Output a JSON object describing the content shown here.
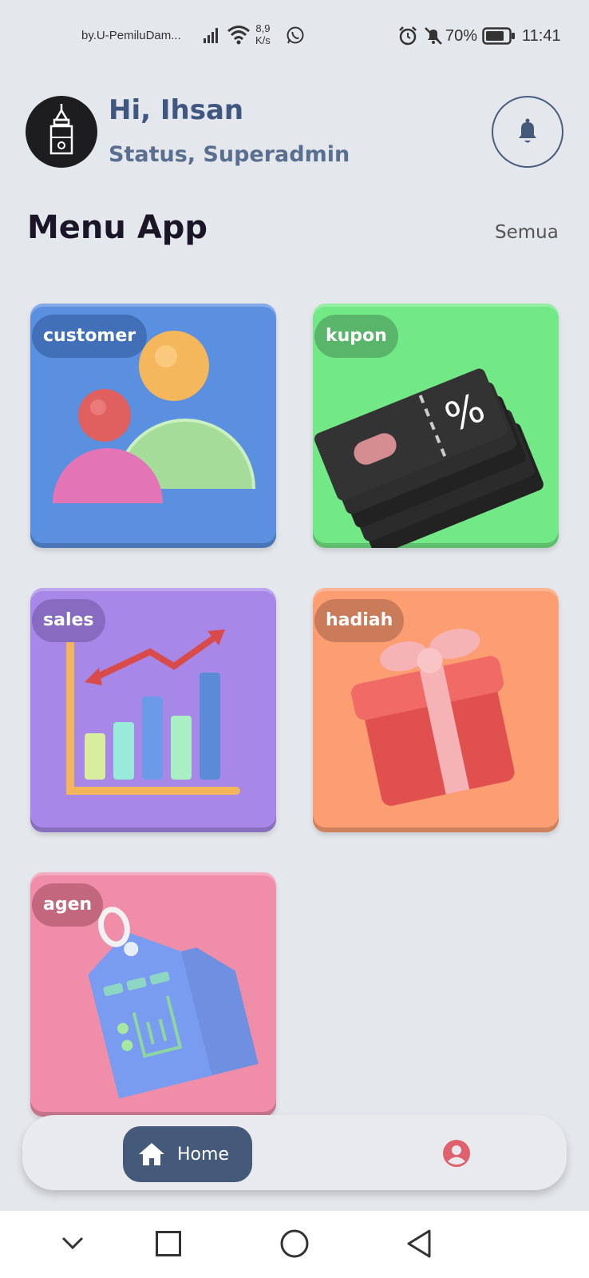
{
  "status_bar": {
    "carrier_text": "by.U-PemiluDam...",
    "speed_top": "8,9",
    "speed_bottom": "K/s",
    "battery": "70%",
    "time": "11:41"
  },
  "header": {
    "greeting": "Hi, Ihsan",
    "status": "Status, Superadmin"
  },
  "section": {
    "title": "Menu App",
    "see_all": "Semua"
  },
  "menu": [
    {
      "label": "customer",
      "color": "#5b8fe0"
    },
    {
      "label": "kupon",
      "color": "#72e886"
    },
    {
      "label": "sales",
      "color": "#a788e8"
    },
    {
      "label": "hadiah",
      "color": "#fc9e72"
    },
    {
      "label": "agen",
      "color": "#f08eaa"
    }
  ],
  "bottom_nav": {
    "home_label": "Home",
    "icons": [
      "home-icon",
      "profile-icon"
    ]
  },
  "colors": {
    "accent": "#455a7b",
    "greeting": "#3f5680",
    "profile": "#e0616e",
    "background": "#e4e7ec"
  }
}
